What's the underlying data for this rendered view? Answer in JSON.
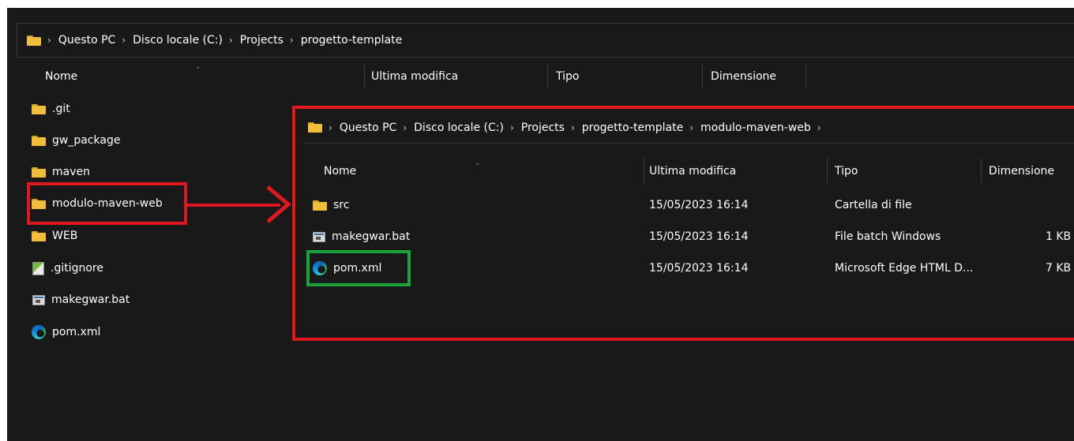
{
  "outer": {
    "breadcrumb": [
      "Questo PC",
      "Disco locale (C:)",
      "Projects",
      "progetto-template"
    ],
    "columns": [
      "Nome",
      "Ultima modifica",
      "Tipo",
      "Dimensione"
    ],
    "items": [
      {
        "name": ".git",
        "icon": "folder-icon"
      },
      {
        "name": "gw_package",
        "icon": "folder-icon"
      },
      {
        "name": "maven",
        "icon": "folder-icon"
      },
      {
        "name": "modulo-maven-web",
        "icon": "folder-icon"
      },
      {
        "name": "WEB",
        "icon": "folder-icon"
      },
      {
        "name": ".gitignore",
        "icon": "gitignore-file-icon"
      },
      {
        "name": "makegwar.bat",
        "icon": "batch-file-icon"
      },
      {
        "name": "pom.xml",
        "icon": "edge-icon"
      }
    ]
  },
  "inner": {
    "breadcrumb": [
      "Questo PC",
      "Disco locale (C:)",
      "Projects",
      "progetto-template",
      "modulo-maven-web"
    ],
    "columns": [
      "Nome",
      "Ultima modifica",
      "Tipo",
      "Dimensione"
    ],
    "items": [
      {
        "name": "src",
        "icon": "folder-icon",
        "modified": "15/05/2023 16:14",
        "type": "Cartella di file",
        "size": ""
      },
      {
        "name": "makegwar.bat",
        "icon": "batch-file-icon",
        "modified": "15/05/2023 16:14",
        "type": "File batch Windows",
        "size": "1 KB"
      },
      {
        "name": "pom.xml",
        "icon": "edge-icon",
        "modified": "15/05/2023 16:14",
        "type": "Microsoft Edge HTML D...",
        "size": "7 KB"
      }
    ]
  },
  "colors": {
    "background": "#191919",
    "highlight_red": "#e0171e",
    "highlight_green": "#1aa33a",
    "folder": "#f0be3a"
  }
}
